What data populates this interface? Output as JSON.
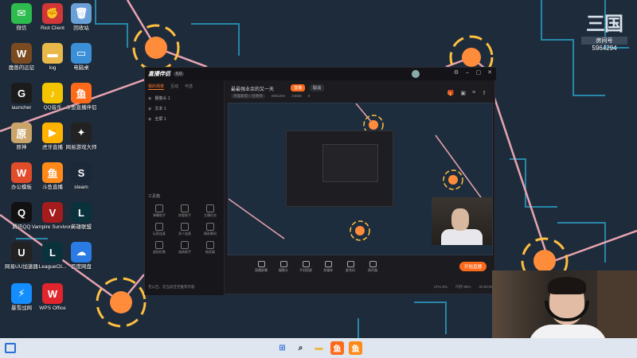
{
  "desktop": {
    "icons": [
      {
        "label": "微信",
        "glyph": "✉",
        "color": "#2dbb4e"
      },
      {
        "label": "Riot Client",
        "glyph": "✊",
        "color": "#d13639"
      },
      {
        "label": "回收站",
        "glyph": "🗑",
        "color": "#6aa0d8"
      },
      {
        "label": "魔兽的远征",
        "glyph": "W",
        "color": "#7a4b20"
      },
      {
        "label": "log",
        "glyph": "▬",
        "color": "#e8b84a"
      },
      {
        "label": "电脑桌",
        "glyph": "▭",
        "color": "#3b8fd6"
      },
      {
        "label": "launcher",
        "glyph": "G",
        "color": "#1b1b1b"
      },
      {
        "label": "QQ音乐",
        "glyph": "♪",
        "color": "#f4c400"
      },
      {
        "label": "斗鱼直播伴侣",
        "glyph": "鱼",
        "color": "#ff6a1a"
      },
      {
        "label": "原神",
        "glyph": "原",
        "color": "#c9a56a"
      },
      {
        "label": "虎牙直播",
        "glyph": "▶",
        "color": "#ffb300"
      },
      {
        "label": "网易游戏大师",
        "glyph": "✦",
        "color": "#222"
      },
      {
        "label": "办公模板",
        "glyph": "W",
        "color": "#e14c2a"
      },
      {
        "label": "斗鱼直播",
        "glyph": "鱼",
        "color": "#ff8a1a"
      },
      {
        "label": "steam",
        "glyph": "S",
        "color": "#1b2838"
      },
      {
        "label": "腾讯QQ",
        "glyph": "Q",
        "color": "#111"
      },
      {
        "label": "Vampire Survivors",
        "glyph": "V",
        "color": "#a51c1c"
      },
      {
        "label": "英雄联盟",
        "glyph": "L",
        "color": "#0a323c"
      },
      {
        "label": "网易UU加速器",
        "glyph": "U",
        "color": "#222"
      },
      {
        "label": "LeagueCli...",
        "glyph": "L",
        "color": "#0a323c"
      },
      {
        "label": "百度网盘",
        "glyph": "☁",
        "color": "#2a7be4"
      },
      {
        "label": "暴雪战网",
        "glyph": "⚡",
        "color": "#148eff"
      },
      {
        "label": "WPS Office",
        "glyph": "W",
        "color": "#e0262c"
      }
    ]
  },
  "brand": {
    "logo": "三国",
    "sub": "房间号",
    "number": "5964294"
  },
  "app": {
    "title": "直播伴侣",
    "badge": "5.0",
    "tabs": [
      "我的场景",
      "互动",
      "可选"
    ],
    "sources": [
      "摄像头 1",
      "文本 1",
      "全屏 1"
    ],
    "tools_heading": "工具箱",
    "tools": [
      "弹幕助手",
      "房管助手",
      "主播任务",
      "玩家连麦",
      "多人连麦",
      "精彩瞬间",
      "虚拟形象",
      "道具助手",
      "抽奖器"
    ],
    "stream_title": "最最强业余的又一天",
    "btn_live_tag": "直播",
    "btn_cancel": "取消",
    "meta": {
      "category": "英雄联盟 > 召唤师",
      "room": "5964294",
      "fans": "24858",
      "gifts": "8"
    },
    "bottom_tools": [
      "直播屏幕",
      "摄像头",
      "手机投屏",
      "多媒体",
      "麦克风",
      "扬声器"
    ],
    "go_live": "开始直播",
    "status_text": "无公告，您当前还无推荐内容",
    "stats": [
      "CPU:6%",
      "内存:58%",
      "00:00:00"
    ]
  },
  "taskbar": {
    "pinned": [
      {
        "name": "windows-start",
        "glyph": "⊞",
        "color": "#2a6fd6"
      },
      {
        "name": "search",
        "glyph": "⌕",
        "color": "#222"
      },
      {
        "name": "explorer",
        "glyph": "▬",
        "color": "#e8b84a"
      },
      {
        "name": "douyu-companion",
        "glyph": "鱼",
        "color": "#ff6a1a"
      },
      {
        "name": "douyu",
        "glyph": "鱼",
        "color": "#ff8a1a"
      }
    ]
  },
  "colors": {
    "accent": "#ff6a1a",
    "node_orange": "#ff8c3a",
    "node_ring": "#ffc040",
    "line_pink": "#e8a4b0",
    "line_cyan": "#3fb7d8"
  }
}
